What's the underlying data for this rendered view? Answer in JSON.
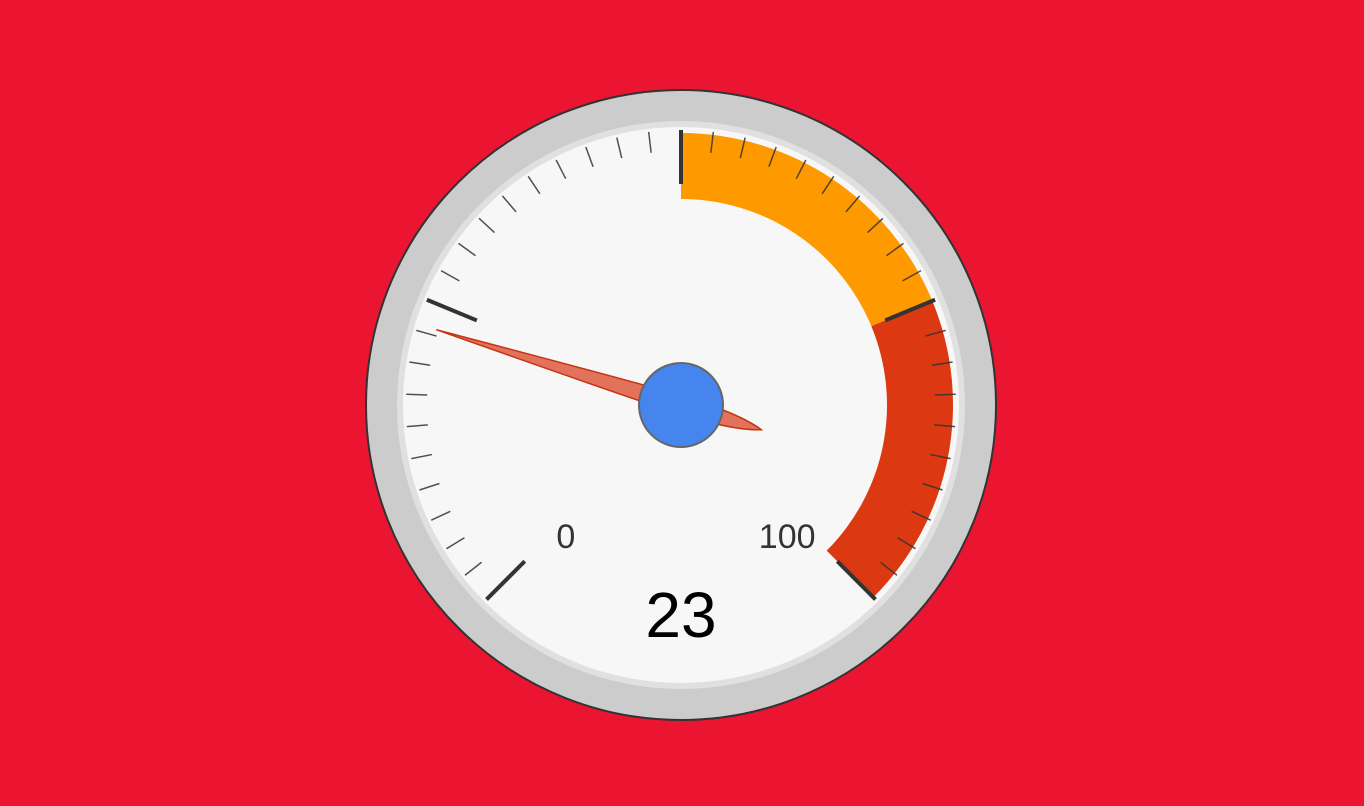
{
  "gauge": {
    "value": 23,
    "value_label": "23",
    "min": 0,
    "max": 100,
    "min_label": "0",
    "max_label": "100",
    "bands": [
      {
        "from": 50,
        "to": 75,
        "color": "#ff9900"
      },
      {
        "from": 75,
        "to": 100,
        "color": "#dc3912"
      }
    ],
    "major_ticks": 4,
    "minor_ticks_per_major": 10,
    "colors": {
      "background": "#ec1531",
      "bezel": "#cccccc",
      "face": "#f7f7f7",
      "needle": "#e2725b",
      "needle_outline": "#c63310",
      "hub": "#4684ee",
      "hub_outline": "#666666",
      "tick": "#333333",
      "label": "#333333",
      "value": "#000000"
    },
    "icons": {
      "needle": "gauge-needle-icon",
      "hub": "gauge-hub-icon"
    }
  }
}
